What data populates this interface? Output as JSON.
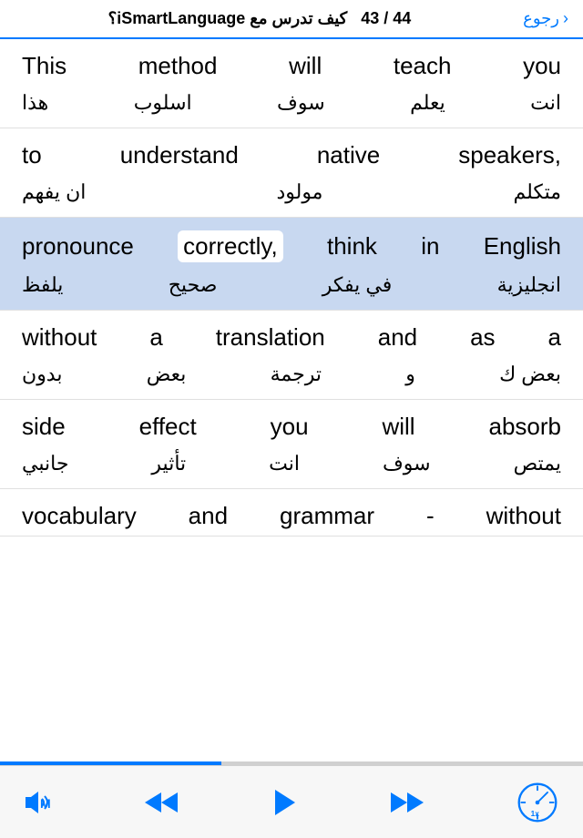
{
  "header": {
    "title": "كيف تدرس مع iSmartLanguage؟",
    "progress": "44 / 43",
    "back_label": "رجوع"
  },
  "lines": [
    {
      "id": 1,
      "english_words": [
        "This",
        "method",
        "will",
        "teach",
        "you"
      ],
      "arabic_words": [
        "انت",
        "يعلم",
        "سوف",
        "اسلوب",
        "هذا"
      ],
      "highlighted": false
    },
    {
      "id": 2,
      "english_words": [
        "to",
        "understand",
        "native",
        "speakers,"
      ],
      "arabic_words": [
        "متكلم",
        "مولود",
        "ان يفهم"
      ],
      "highlighted": false
    },
    {
      "id": 3,
      "english_words": [
        "pronounce",
        "correctly,",
        "think",
        "in",
        "English"
      ],
      "arabic_words": [
        "انجليزية",
        "في يفكر",
        "صحيح",
        "يلفظ"
      ],
      "highlighted": true,
      "highlight_word_index": 1
    },
    {
      "id": 4,
      "english_words": [
        "without",
        "a",
        "translation",
        "and",
        "as",
        "a"
      ],
      "arabic_words": [
        "بعض ك",
        "و",
        "ترجمة",
        "بعض",
        "بدون"
      ],
      "highlighted": false
    },
    {
      "id": 5,
      "english_words": [
        "side",
        "effect",
        "you",
        "will",
        "absorb"
      ],
      "arabic_words": [
        "يمتص",
        "سوف",
        "انت",
        "تأثير",
        "جانبي"
      ],
      "highlighted": false
    },
    {
      "id": 6,
      "english_words": [
        "vocabulary",
        "and",
        "grammar",
        "-",
        "without"
      ],
      "arabic_words": [],
      "highlighted": false,
      "partial": true
    }
  ],
  "player": {
    "volume_label": "M",
    "rewind_label": "⏪",
    "play_label": "▶",
    "forward_label": "⏩",
    "speed_label": "1x"
  },
  "progress_percent": 38
}
